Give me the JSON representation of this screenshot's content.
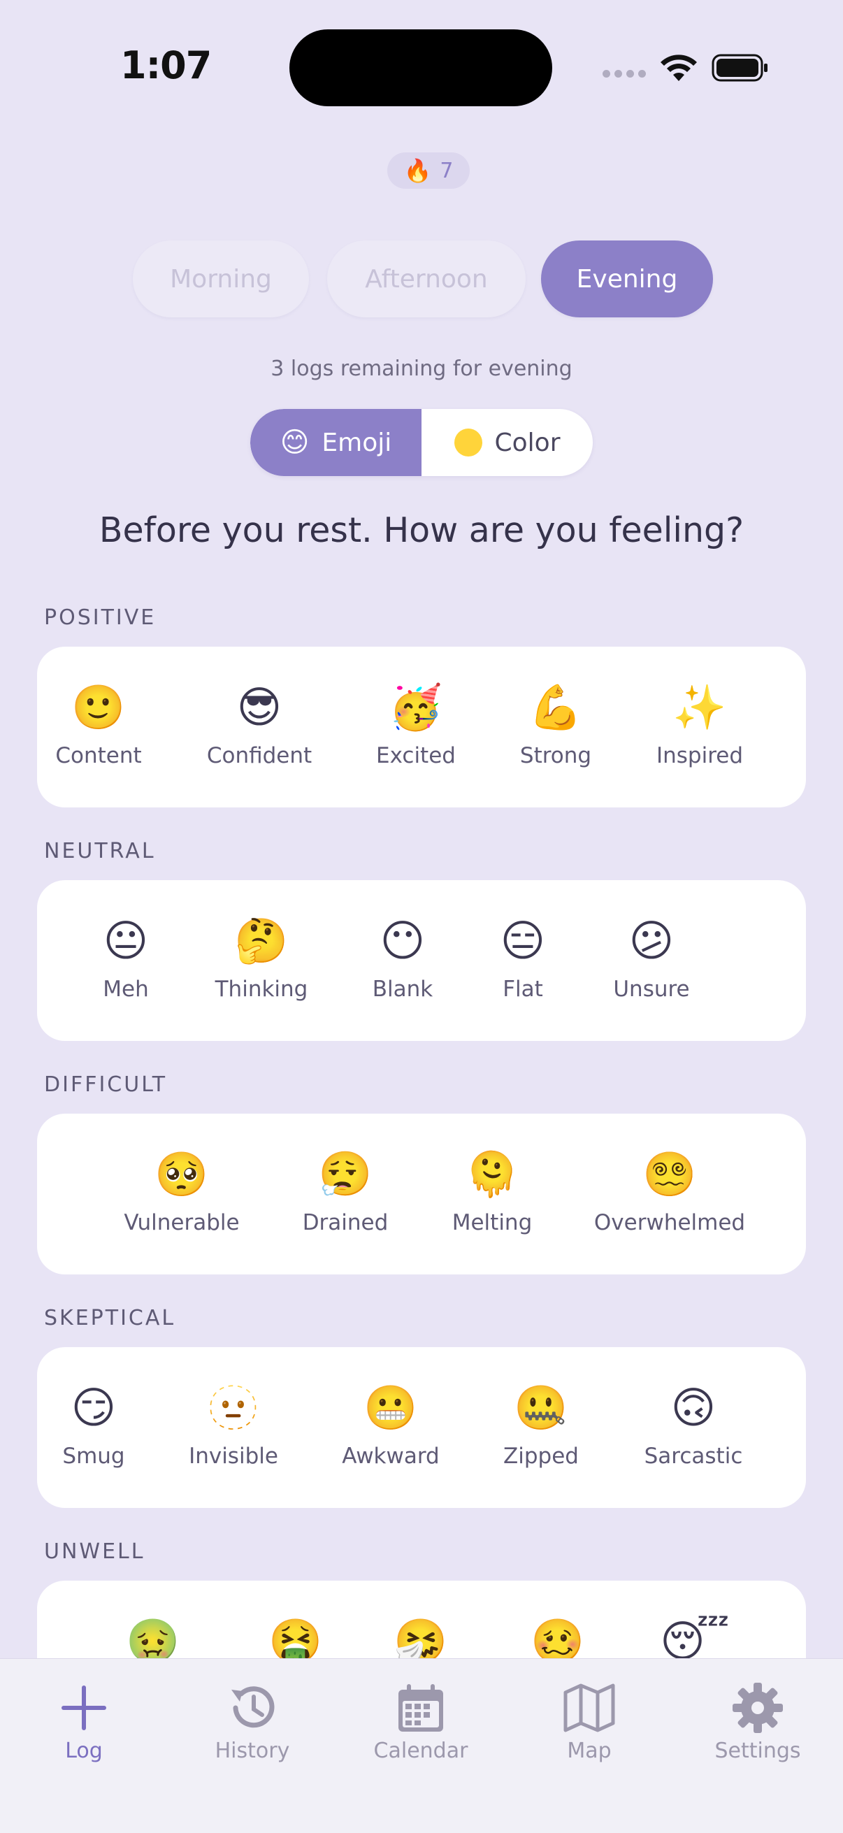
{
  "status_bar": {
    "time": "1:07"
  },
  "streak": {
    "count": "7"
  },
  "periods": [
    {
      "label": "Morning",
      "active": false
    },
    {
      "label": "Afternoon",
      "active": false
    },
    {
      "label": "Evening",
      "active": true
    }
  ],
  "remaining_text": "3 logs remaining for evening",
  "mode_toggle": {
    "emoji_label": "Emoji",
    "color_label": "Color",
    "active": "Emoji"
  },
  "prompt": "Before you rest. How are you feeling?",
  "categories": [
    {
      "label": "POSITIVE",
      "items": [
        {
          "emoji": "🙂",
          "label": "Content"
        },
        {
          "emoji": "😎",
          "label": "Confident"
        },
        {
          "emoji": "🥳",
          "label": "Excited"
        },
        {
          "emoji": "💪",
          "label": "Strong"
        },
        {
          "emoji": "✨",
          "label": "Inspired"
        }
      ]
    },
    {
      "label": "NEUTRAL",
      "items": [
        {
          "emoji": "😐",
          "label": "Meh"
        },
        {
          "emoji": "🤔",
          "label": "Thinking"
        },
        {
          "emoji": "😶",
          "label": "Blank"
        },
        {
          "emoji": "😑",
          "label": "Flat"
        },
        {
          "emoji": "😕",
          "label": "Unsure"
        }
      ]
    },
    {
      "label": "DIFFICULT",
      "items": [
        {
          "emoji": "🥺",
          "label": "Vulnerable"
        },
        {
          "emoji": "😮‍💨",
          "label": "Drained"
        },
        {
          "emoji": "🫠",
          "label": "Melting"
        },
        {
          "emoji": "😵‍💫",
          "label": "Overwhelmed"
        }
      ]
    },
    {
      "label": "SKEPTICAL",
      "items": [
        {
          "emoji": "😏",
          "label": "Smug"
        },
        {
          "emoji": "🫥",
          "label": "Invisible"
        },
        {
          "emoji": "😬",
          "label": "Awkward"
        },
        {
          "emoji": "🤐",
          "label": "Zipped"
        },
        {
          "emoji": "🙃",
          "label": "Sarcastic"
        }
      ]
    },
    {
      "label": "UNWELL",
      "items": [
        {
          "emoji": "🤢",
          "label": ""
        },
        {
          "emoji": "🤮",
          "label": ""
        },
        {
          "emoji": "🤧",
          "label": ""
        },
        {
          "emoji": "🥴",
          "label": ""
        },
        {
          "emoji": "😴",
          "label": ""
        }
      ]
    }
  ],
  "tabs": [
    {
      "label": "Log",
      "icon": "plus-icon",
      "active": true
    },
    {
      "label": "History",
      "icon": "history-icon",
      "active": false
    },
    {
      "label": "Calendar",
      "icon": "calendar-icon",
      "active": false
    },
    {
      "label": "Map",
      "icon": "map-icon",
      "active": false
    },
    {
      "label": "Settings",
      "icon": "gear-icon",
      "active": false
    }
  ],
  "colors": {
    "accent": "#8c80c8",
    "background": "#e8e4f5",
    "card": "#ffffff",
    "color_dot": "#ffd43a"
  }
}
